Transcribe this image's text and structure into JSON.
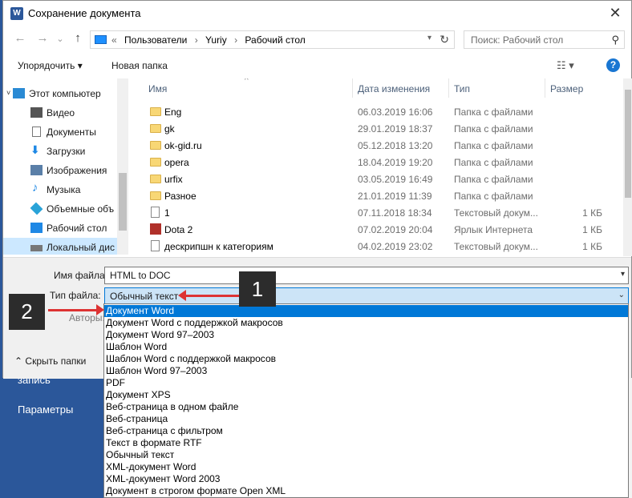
{
  "background": {
    "items": [
      "запись",
      "Параметры"
    ]
  },
  "dialog": {
    "title": "Сохранение документа",
    "app_icon": "W"
  },
  "address": {
    "crumbs": [
      "«",
      "Пользователи",
      "›",
      "Yuriy",
      "›",
      "Рабочий стол"
    ],
    "search_placeholder": "Поиск: Рабочий стол"
  },
  "commands": {
    "organize": "Упорядочить ▾",
    "new_folder": "Новая папка"
  },
  "nav": {
    "items": [
      {
        "label": "Этот компьютер",
        "icon": "computer-icon",
        "color": "#2a8ad4"
      },
      {
        "label": "Видео",
        "icon": "video-icon",
        "color": "#555555"
      },
      {
        "label": "Документы",
        "icon": "documents-icon",
        "color": "#777777"
      },
      {
        "label": "Загрузки",
        "icon": "downloads-icon",
        "color": "#1e88e5"
      },
      {
        "label": "Изображения",
        "icon": "pictures-icon",
        "color": "#5a7fa8"
      },
      {
        "label": "Музыка",
        "icon": "music-icon",
        "color": "#1e88e5"
      },
      {
        "label": "Объемные объ",
        "icon": "3d-objects-icon",
        "color": "#29a3d8"
      },
      {
        "label": "Рабочий стол",
        "icon": "desktop-icon",
        "color": "#1e88e5"
      },
      {
        "label": "Локальный дис",
        "icon": "drive-icon",
        "color": "#777777"
      }
    ]
  },
  "columns": {
    "name": "Имя",
    "date": "Дата изменения",
    "type": "Тип",
    "size": "Размер"
  },
  "files": [
    {
      "name": "Eng",
      "date": "06.03.2019 16:06",
      "type": "Папка с файлами",
      "size": "",
      "kind": "folder"
    },
    {
      "name": "gk",
      "date": "29.01.2019 18:37",
      "type": "Папка с файлами",
      "size": "",
      "kind": "folder"
    },
    {
      "name": "ok-gid.ru",
      "date": "05.12.2018 13:20",
      "type": "Папка с файлами",
      "size": "",
      "kind": "folder"
    },
    {
      "name": "opera",
      "date": "18.04.2019 19:20",
      "type": "Папка с файлами",
      "size": "",
      "kind": "folder"
    },
    {
      "name": "urfix",
      "date": "03.05.2019 16:49",
      "type": "Папка с файлами",
      "size": "",
      "kind": "folder"
    },
    {
      "name": "Разное",
      "date": "21.01.2019 11:39",
      "type": "Папка с файлами",
      "size": "",
      "kind": "folder"
    },
    {
      "name": "1",
      "date": "07.11.2018 18:34",
      "type": "Текстовый докум...",
      "size": "1 КБ",
      "kind": "doc"
    },
    {
      "name": "Dota 2",
      "date": "07.02.2019 20:04",
      "type": "Ярлык Интернета",
      "size": "1 КБ",
      "kind": "link"
    },
    {
      "name": "дескрипшн к категориям",
      "date": "04.02.2019 23:02",
      "type": "Текстовый докум...",
      "size": "1 КБ",
      "kind": "doc"
    }
  ],
  "form": {
    "filename_label": "Имя файла:",
    "filename_value": "HTML to DOC",
    "filetype_label": "Тип файла:",
    "filetype_value": "Обычный текст",
    "authors_label": "Авторы:",
    "hide_folders": "Скрыть папки"
  },
  "filetypes": [
    "Документ Word",
    "Документ Word с поддержкой макросов",
    "Документ Word 97–2003",
    "Шаблон Word",
    "Шаблон Word с поддержкой макросов",
    "Шаблон Word 97–2003",
    "PDF",
    "Документ XPS",
    "Веб-страница в одном файле",
    "Веб-страница",
    "Веб-страница с фильтром",
    "Текст в формате RTF",
    "Обычный текст",
    "XML-документ Word",
    "XML-документ Word 2003",
    "Документ в строгом формате Open XML"
  ],
  "selected_filetype_index": 0,
  "annotations": {
    "callout_1": "1",
    "callout_2": "2",
    "arrow_color": "#d33333"
  }
}
